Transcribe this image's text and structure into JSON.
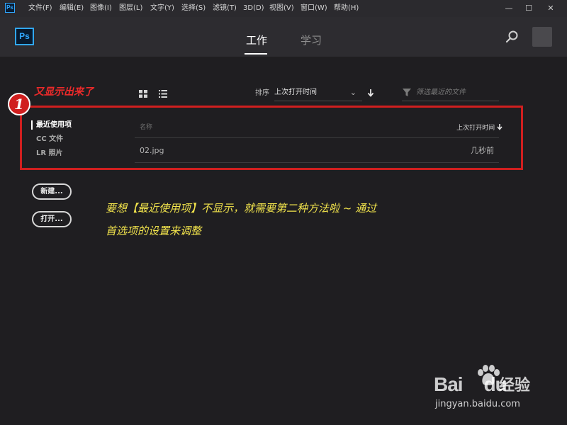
{
  "menubar": {
    "app_icon": "Ps",
    "items": [
      "文件(F)",
      "编辑(E)",
      "图像(I)",
      "图层(L)",
      "文字(Y)",
      "选择(S)",
      "滤镜(T)",
      "3D(D)",
      "视图(V)",
      "窗口(W)",
      "帮助(H)"
    ],
    "window_controls": {
      "minimize": "—",
      "maximize": "☐",
      "close": "✕"
    }
  },
  "header": {
    "logo": "Ps",
    "tabs": [
      {
        "label": "工作",
        "active": true
      },
      {
        "label": "学习",
        "active": false
      }
    ],
    "search_icon": "search-icon"
  },
  "toolbar": {
    "sort_label": "排序",
    "sort_value": "上次打开时间",
    "sort_chevron": "⌄",
    "filter_placeholder": "筛选最近的文件"
  },
  "sidebar": {
    "items": [
      {
        "label": "最近使用项",
        "active": true
      },
      {
        "label": "CC 文件",
        "active": false
      },
      {
        "label": "LR 照片",
        "active": false
      }
    ]
  },
  "files": {
    "columns": {
      "name": "名称",
      "time": "上次打开时间"
    },
    "rows": [
      {
        "name": "02.jpg",
        "time": "几秒前"
      }
    ]
  },
  "buttons": {
    "new": "新建...",
    "open": "打开..."
  },
  "annotation": {
    "step": "1",
    "red_text": "又显示出来了",
    "yellow_line1": "要想【最近使用项】不显示，就需要第二种方法啦 ~ 通过",
    "yellow_line2": "首选项的设置来调整",
    "highlight_color": "#d01f1f",
    "note_color": "#f2e44c"
  },
  "watermark": {
    "bai": "Bai",
    "du": "du",
    "jingyan": "经验",
    "url": "jingyan.baidu.com"
  },
  "colors": {
    "accent": "#31a8ff",
    "background": "#1f1e21",
    "header": "#2d2c30"
  }
}
